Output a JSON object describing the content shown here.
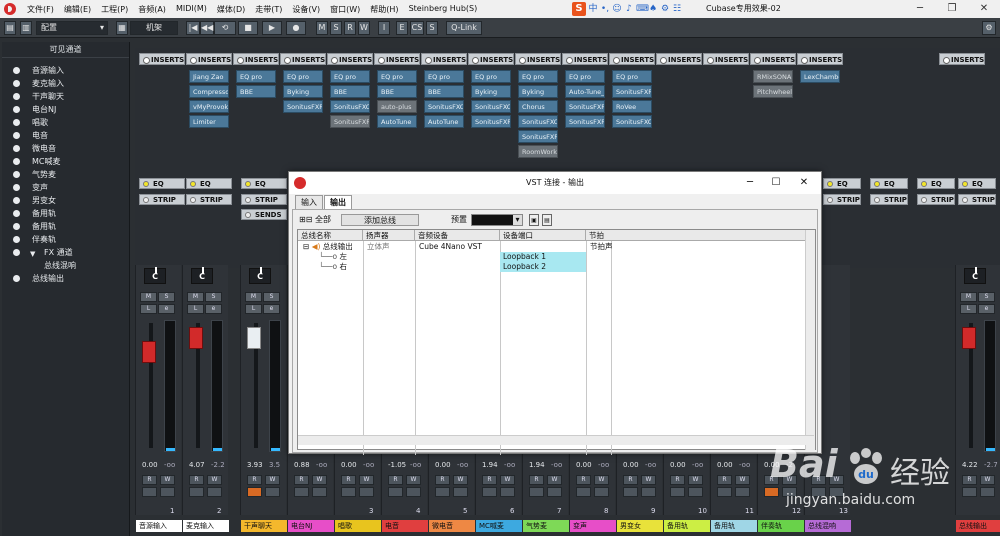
{
  "app": {
    "menus": [
      "文件(F)",
      "编辑(E)",
      "工程(P)",
      "音频(A)",
      "MIDI(M)",
      "媒体(D)",
      "走带(T)",
      "设备(V)",
      "窗口(W)",
      "帮助(H)",
      "Steinberg Hub(S)"
    ],
    "window_title": "Cubase专用效果-02",
    "ime_labels": [
      "中"
    ]
  },
  "toolbar": {
    "config_label": "配置",
    "rack_label": "机架",
    "msrw": [
      "M",
      "S",
      "R",
      "W"
    ],
    "iecs": [
      "I",
      "E",
      "CS",
      "S"
    ],
    "qlink": "Q-Link"
  },
  "left_panel": {
    "header": "可见通道",
    "items": [
      "音源输入",
      "麦克输入",
      "干声聊天",
      "电台NJ",
      "唱歌",
      "电音",
      "微电音",
      "MC喊麦",
      "气势麦",
      "变声",
      "男变女",
      "备用轨",
      "备用轨",
      "伴奏轨",
      "FX 通道",
      "总线混响",
      "总线输出"
    ]
  },
  "rack": {
    "inserts_label": "INSERTS",
    "eq_label": "EQ",
    "strip_label": "STRIP",
    "sends_label": "SENDS",
    "columns": [
      {
        "slots": []
      },
      {
        "slots": [
          "Jiang Zao",
          "Compressor",
          "vMyProvoker",
          "Limiter"
        ]
      },
      {
        "slots": [
          "EQ pro",
          "BBE"
        ]
      },
      {
        "slots": [
          "EQ pro",
          "Byking",
          "SonitusFXR",
          ""
        ]
      },
      {
        "slots": [
          "EQ pro",
          "BBE",
          "SonitusFXC",
          "SonitusFXR"
        ]
      },
      {
        "slots": [
          "EQ pro",
          "BBE",
          "auto-plus",
          "AutoTune"
        ]
      },
      {
        "slots": [
          "EQ pro",
          "BBE",
          "SonitusFXC",
          "AutoTune"
        ]
      },
      {
        "slots": [
          "EQ pro",
          "Byking",
          "SonitusFXC",
          "SonitusFXR"
        ]
      },
      {
        "slots": [
          "EQ pro",
          "Byking",
          "Chorus",
          "SonitusFXC",
          "SonitusFXR",
          "RoomWorks"
        ]
      },
      {
        "slots": [
          "EQ pro",
          "Auto-Tune_f",
          "SonitusFXR",
          "SonitusFXR"
        ]
      },
      {
        "slots": [
          "EQ pro",
          "SonitusFXR",
          "RoVee",
          "SonitusFXC"
        ]
      },
      {
        "slots": []
      },
      {
        "slots": []
      },
      {
        "slots": [
          "RMixSONAR",
          "Pitchwheel"
        ]
      },
      {
        "slots": [
          "LexChamber"
        ]
      }
    ]
  },
  "mixer": {
    "pan_label": "C",
    "strips": [
      {
        "name": "音源输入",
        "val1": "0.00",
        "val2": "-oo",
        "num": "1",
        "color": "#ffffff",
        "fader": "red"
      },
      {
        "name": "麦克输入",
        "val1": "4.07",
        "val2": "-2.2",
        "num": "2",
        "color": "#ffffff",
        "fader": "red"
      },
      {
        "name": "干声聊天",
        "val1": "3.93",
        "val2": "3.5",
        "num": "",
        "color": "#f4b82c",
        "fader": "white"
      },
      {
        "name": "电台NJ",
        "val1": "0.88",
        "val2": "-oo",
        "num": "",
        "color": "#e74ec8",
        "fader": "none"
      },
      {
        "name": "唱歌",
        "val1": "0.00",
        "val2": "-oo",
        "num": "3",
        "color": "#e8c41e",
        "fader": "none"
      },
      {
        "name": "电音",
        "val1": "-1.05",
        "val2": "-oo",
        "num": "4",
        "color": "#e03f3f",
        "fader": "none"
      },
      {
        "name": "微电音",
        "val1": "0.00",
        "val2": "-oo",
        "num": "5",
        "color": "#ee8844",
        "fader": "none"
      },
      {
        "name": "MC喊麦",
        "val1": "1.94",
        "val2": "-oo",
        "num": "6",
        "color": "#3da9e0",
        "fader": "none"
      },
      {
        "name": "气势麦",
        "val1": "1.94",
        "val2": "-oo",
        "num": "7",
        "color": "#7ed957",
        "fader": "none"
      },
      {
        "name": "变声",
        "val1": "0.00",
        "val2": "-oo",
        "num": "8",
        "color": "#e74ec8",
        "fader": "none"
      },
      {
        "name": "男变女",
        "val1": "0.00",
        "val2": "-oo",
        "num": "9",
        "color": "#e8e23a",
        "fader": "none"
      },
      {
        "name": "备用轨",
        "val1": "0.00",
        "val2": "-oo",
        "num": "10",
        "color": "#ccee44",
        "fader": "none"
      },
      {
        "name": "备用轨",
        "val1": "0.00",
        "val2": "-oo",
        "num": "11",
        "color": "#9fd6e6",
        "fader": "none"
      },
      {
        "name": "伴奏轨",
        "val1": "0.00",
        "val2": "-2",
        "num": "12",
        "color": "#69d24a",
        "fader": "none"
      },
      {
        "name": "总线混响",
        "val1": "",
        "val2": "",
        "num": "13",
        "color": "#b66bd6",
        "fader": "none"
      },
      {
        "name": "总线输出",
        "val1": "4.22",
        "val2": "-2.7",
        "num": "",
        "color": "#e03f3f",
        "fader": "red"
      }
    ]
  },
  "dialog": {
    "title": "VST 连接 - 输出",
    "tab_input": "输入",
    "tab_output": "输出",
    "expand_all": "全部",
    "add_bus": "添加总线",
    "preset_label": "预置",
    "headers": [
      "总线名称",
      "扬声器",
      "音频设备",
      "设备端口",
      "节拍"
    ],
    "rows": [
      {
        "name": "总线输出",
        "speaker": "立体声",
        "device": "Cube 4Nano VST",
        "port": "",
        "click": "节拍声"
      },
      {
        "name": "左",
        "speaker": "",
        "device": "",
        "port": "Loopback 1",
        "click": ""
      },
      {
        "name": "右",
        "speaker": "",
        "device": "",
        "port": "Loopback 2",
        "click": ""
      }
    ]
  },
  "watermark": {
    "brand": "Bai",
    "brand_suffix": "经验",
    "url": "jingyan.baidu.com"
  }
}
